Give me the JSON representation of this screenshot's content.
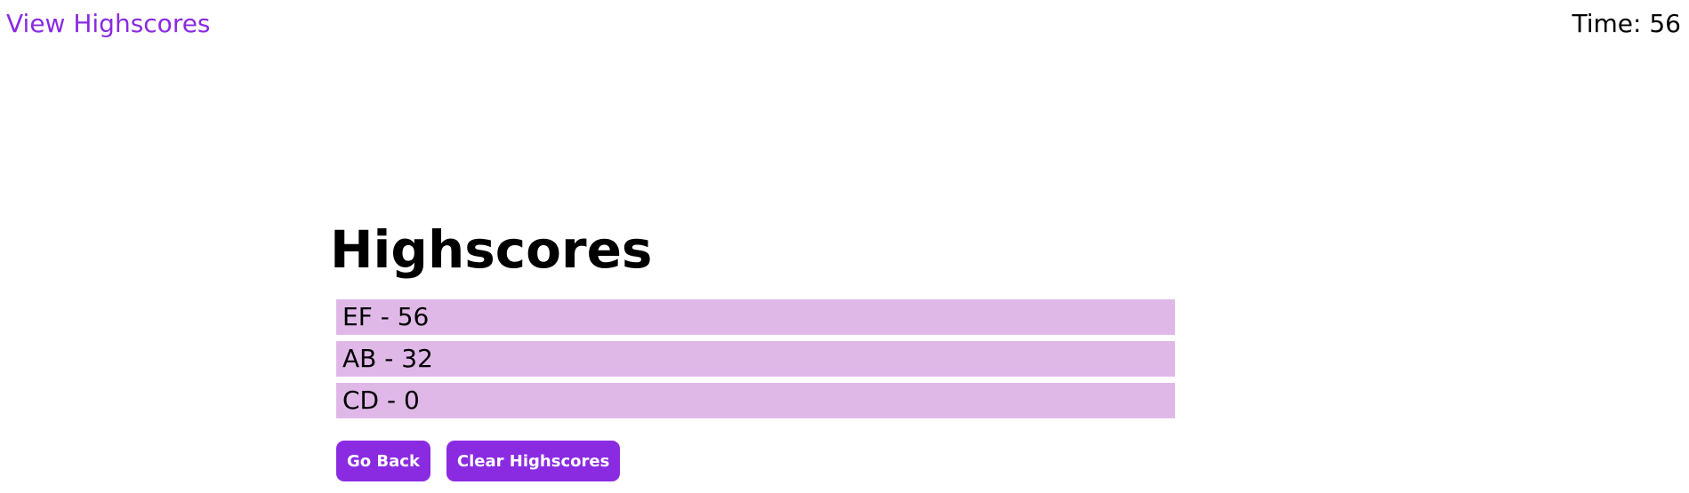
{
  "header": {
    "view_highscores_label": "View Highscores",
    "timer_text": "Time: 56"
  },
  "main": {
    "title": "Highscores",
    "scores": [
      {
        "text": "EF - 56"
      },
      {
        "text": "AB - 32"
      },
      {
        "text": "CD - 0"
      }
    ],
    "buttons": {
      "go_back_label": "Go Back",
      "clear_label": "Clear Highscores"
    }
  },
  "colors": {
    "accent": "#8a2be2",
    "score_background": "#e0b8e8",
    "text": "#000000",
    "button_text": "#ffffff"
  }
}
